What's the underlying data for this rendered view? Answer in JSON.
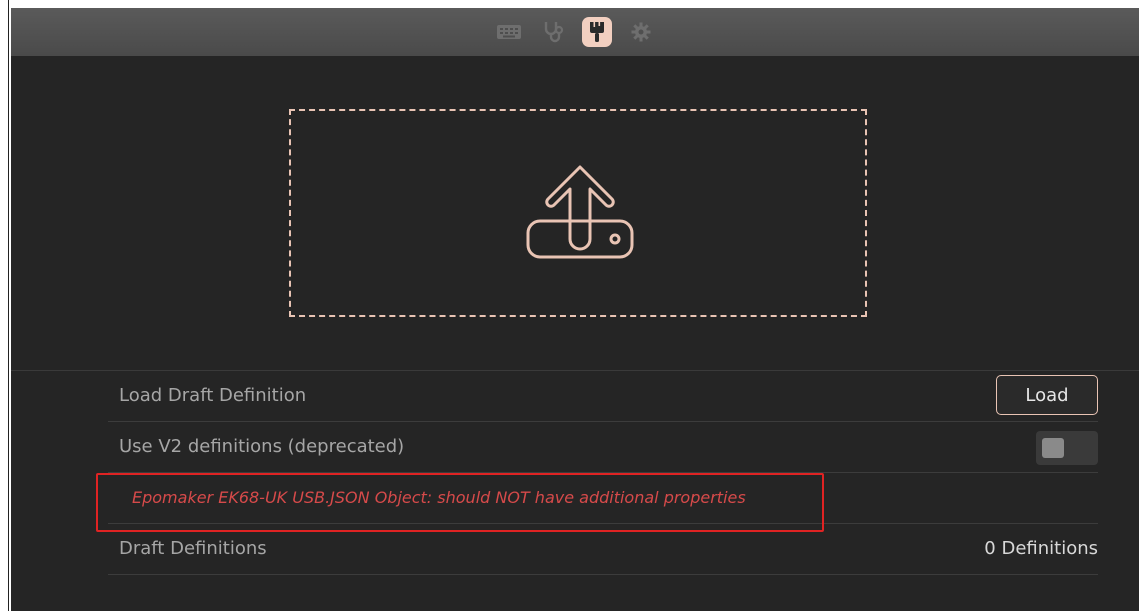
{
  "nav": {
    "items": [
      {
        "icon": "keyboard-icon",
        "active": false
      },
      {
        "icon": "stethoscope-icon",
        "active": false
      },
      {
        "icon": "paintbrush-icon",
        "active": true
      },
      {
        "icon": "gear-icon",
        "active": false
      }
    ]
  },
  "upload": {
    "icon": "upload-icon"
  },
  "rows": {
    "load_draft": {
      "label": "Load Draft Definition",
      "button": "Load"
    },
    "use_v2": {
      "label": "Use V2 definitions (deprecated)",
      "enabled": false
    },
    "error": {
      "message": "Epomaker EK68-UK USB.JSON Object: should NOT have additional properties"
    },
    "draft_definitions": {
      "label": "Draft Definitions",
      "count": "0 Definitions"
    }
  },
  "colors": {
    "accent": "#e9c4b4",
    "error": "#d64a4a",
    "highlight_box": "#e02323",
    "background": "#252525",
    "topbar": "#4f4f4f"
  }
}
